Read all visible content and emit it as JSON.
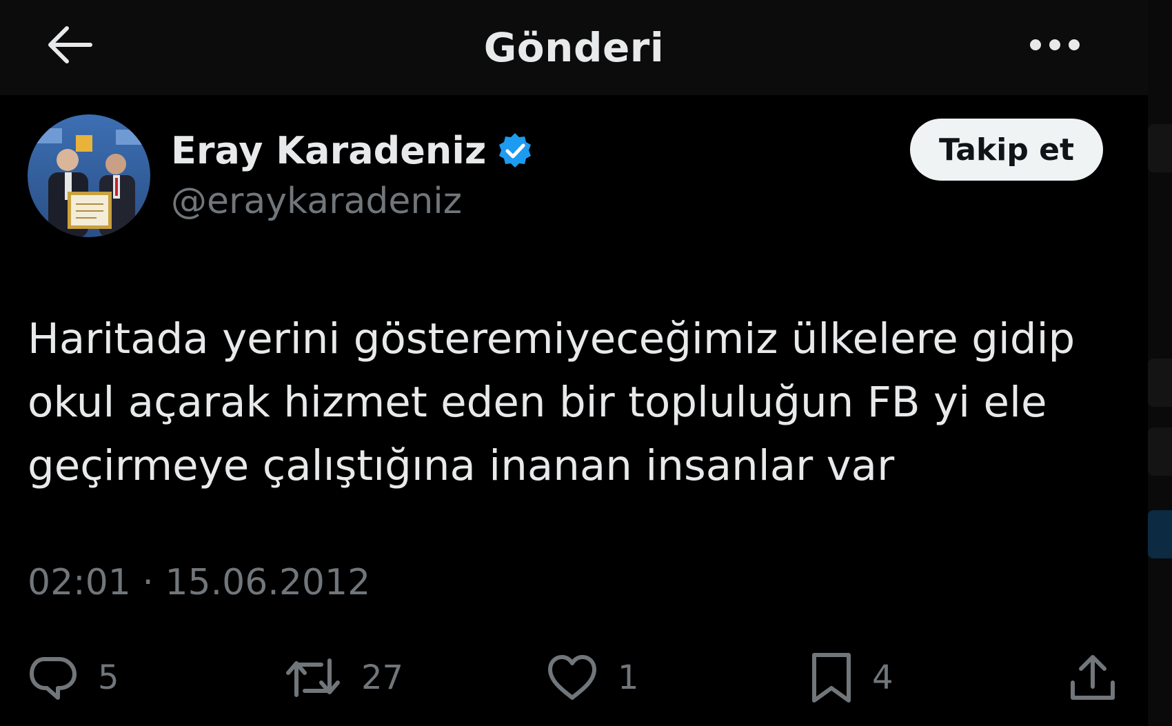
{
  "header": {
    "title": "Gönderi"
  },
  "icons": {
    "back": "arrow-left-icon",
    "more": "more-horizontal-icon",
    "verified": "verified-badge-icon",
    "reply": "reply-icon",
    "retweet": "retweet-icon",
    "like": "heart-icon",
    "bookmark": "bookmark-icon",
    "share": "share-icon"
  },
  "colors": {
    "background": "#000000",
    "header_bg": "#0c0c0c",
    "text": "#e7e9ea",
    "muted": "#71767b",
    "verified": "#1d9bf0",
    "follow_bg": "#eff3f4"
  },
  "author": {
    "name": "Eray Karadeniz",
    "handle": "@eraykaradeniz"
  },
  "follow_label": "Takip et",
  "tweet": {
    "line1": "Haritada yerini gösteremiyeceğimiz ülkelere gidip",
    "line2": "okul açarak hizmet eden bir topluluğun FB yi ele",
    "line3": "geçirmeye çalıştığına inanan insanlar var"
  },
  "timestamp": "02:01 · 15.06.2012",
  "metrics": {
    "replies": "5",
    "retweets": "27",
    "likes": "1",
    "bookmarks": "4"
  }
}
